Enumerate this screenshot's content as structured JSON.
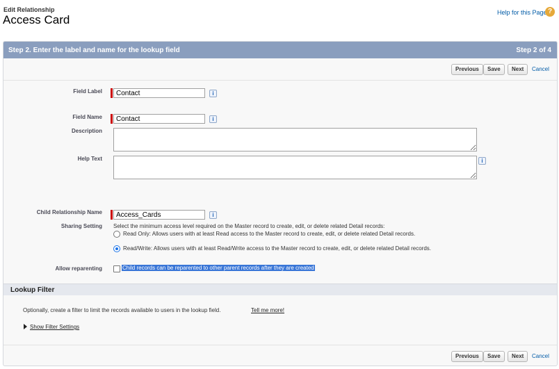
{
  "header": {
    "breadcrumb": "Edit Relationship",
    "title": "Access Card",
    "help_link": "Help for this Page",
    "help_icon": "?"
  },
  "panel": {
    "step_title": "Step 2. Enter the label and name for the lookup field",
    "step_count": "Step 2 of 4"
  },
  "buttons": {
    "previous": "Previous",
    "save": "Save",
    "next": "Next",
    "cancel": "Cancel"
  },
  "form": {
    "field_label": {
      "label": "Field Label",
      "value": "Contact"
    },
    "field_name": {
      "label": "Field Name",
      "value": "Contact"
    },
    "description": {
      "label": "Description",
      "value": ""
    },
    "help_text": {
      "label": "Help Text",
      "value": ""
    },
    "child_relationship_name": {
      "label": "Child Relationship Name",
      "value": "Access_Cards"
    },
    "sharing_setting": {
      "label": "Sharing Setting",
      "intro": "Select the minimum access level required on the Master record to create, edit, or delete related Detail records:",
      "options": [
        {
          "label": "Read Only: Allows users with at least Read access to the Master record to create, edit, or delete related Detail records.",
          "selected": false
        },
        {
          "label": "Read/Write: Allows users with at least Read/Write access to the Master record to create, edit, or delete related Detail records.",
          "selected": true
        }
      ]
    },
    "allow_reparenting": {
      "label": "Allow reparenting",
      "checkbox_label": "Child records can be reparented to other parent records after they are created",
      "checked": false
    },
    "info_icon": "i"
  },
  "lookup_filter": {
    "heading": "Lookup Filter",
    "text": "Optionally, create a filter to limit the records available to users in the lookup field.",
    "tell_me_more": "Tell me more!",
    "show_filter_settings": "Show Filter Settings"
  },
  "colors": {
    "panel_header": "#8a9ebe",
    "link": "#015ba7",
    "required": "#cc0000",
    "selection": "#3875d7"
  }
}
